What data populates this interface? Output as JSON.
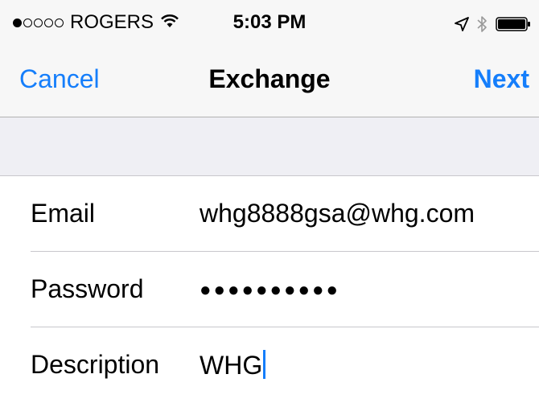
{
  "status_bar": {
    "carrier": "ROGERS",
    "time": "5:03 PM",
    "signal_filled": 1,
    "signal_total": 5,
    "icons": [
      "wifi-icon",
      "location-icon",
      "bluetooth-icon",
      "battery-icon"
    ]
  },
  "nav": {
    "cancel_label": "Cancel",
    "title": "Exchange",
    "next_label": "Next"
  },
  "form": {
    "email": {
      "label": "Email",
      "value": "whg8888gsa@whg.com"
    },
    "password": {
      "label": "Password",
      "value": "●●●●●●●●●●"
    },
    "description": {
      "label": "Description",
      "value": "WHG"
    }
  },
  "colors": {
    "accent": "#157efb",
    "bar_background": "#f7f7f7",
    "group_background": "#efeff4",
    "separator": "#c8c7cc"
  }
}
